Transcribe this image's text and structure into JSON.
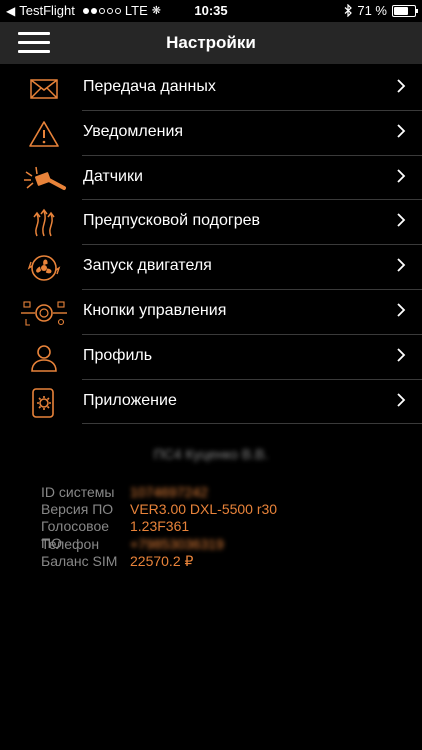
{
  "status_bar": {
    "back_app": "TestFlight",
    "carrier": "LTE",
    "time": "10:35",
    "battery": "71 %",
    "battery_level": 0.71
  },
  "nav": {
    "title": "Настройки",
    "menu_icon": "hamburger-icon"
  },
  "accent_color": "#e8833a",
  "menu": [
    {
      "label": "Передача данных",
      "icon": "envelope-icon"
    },
    {
      "label": "Уведомления",
      "icon": "warning-icon"
    },
    {
      "label": "Датчики",
      "icon": "hammer-shock-icon"
    },
    {
      "label": "Предпусковой подогрев",
      "icon": "heat-arrows-icon"
    },
    {
      "label": "Запуск двигателя",
      "icon": "engine-fan-icon"
    },
    {
      "label": "Кнопки управления",
      "icon": "control-buttons-icon"
    },
    {
      "label": "Профиль",
      "icon": "user-icon"
    },
    {
      "label": "Приложение",
      "icon": "phone-gear-icon"
    }
  ],
  "info": {
    "owner": "ПС4 Куценко В.В.",
    "rows": [
      {
        "key": "ID системы",
        "value": "1074697242"
      },
      {
        "key": "Версия ПО",
        "value": "VER3.00 DXL-5500 r30"
      },
      {
        "key": "Голосовое ПО",
        "value": "1.23F361"
      },
      {
        "key": "Телефон",
        "value": "+79853036319"
      },
      {
        "key": "Баланс SIM",
        "value": "22570.2 ₽"
      }
    ]
  }
}
